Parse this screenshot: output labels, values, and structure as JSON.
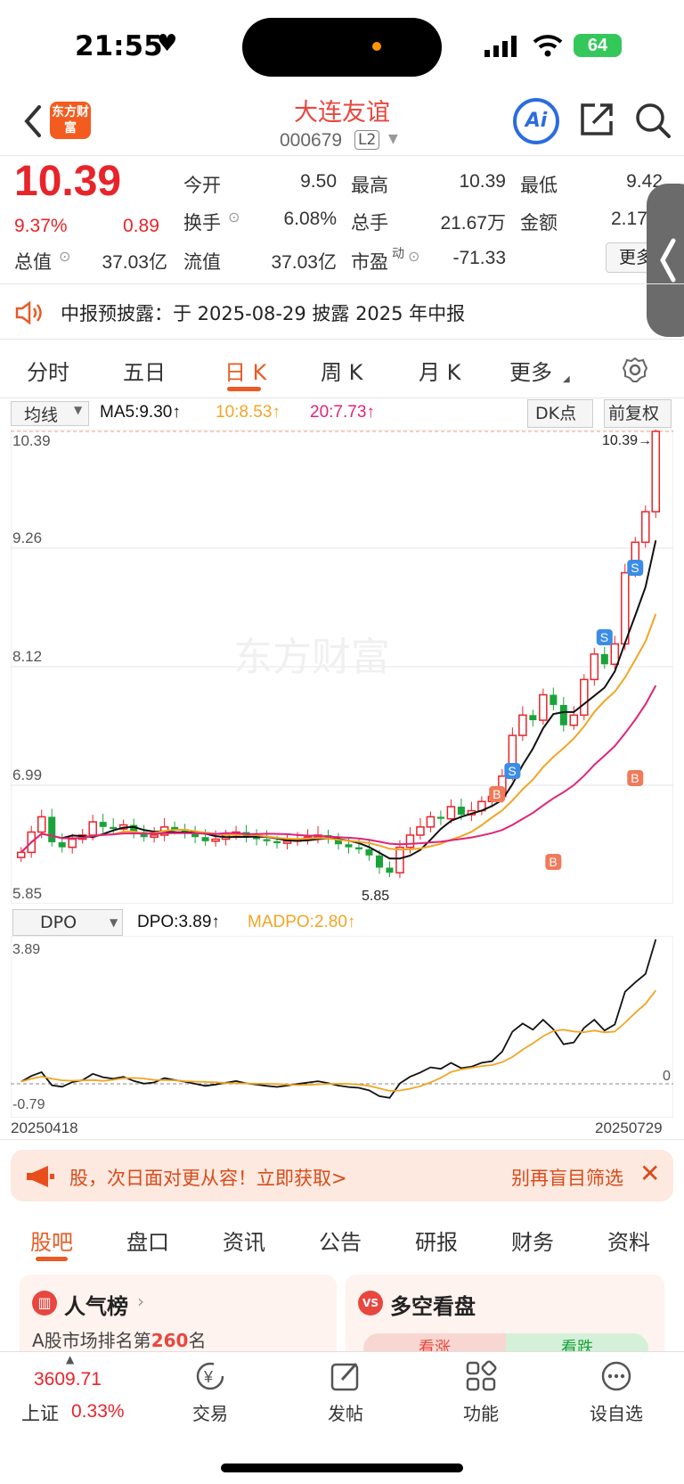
{
  "status": {
    "time": "21:55",
    "battery": "64"
  },
  "header": {
    "logo": "东方财富",
    "title": "大连友谊",
    "code": "000679",
    "level": "L2",
    "ai_label": "Ai"
  },
  "quote": {
    "price": "10.39",
    "change_pct": "9.37%",
    "change": "0.89",
    "open_label": "今开",
    "open": "9.50",
    "high_label": "最高",
    "high": "10.39",
    "low_label": "最低",
    "low": "9.42",
    "turnover_label": "换手",
    "turnover": "6.08%",
    "volume_label": "总手",
    "volume": "21.67万",
    "amount_label": "金额",
    "amount": "2.17",
    "total_mv_label": "总值",
    "total_mv": "37.03亿",
    "float_mv_label": "流值",
    "float_mv": "37.03亿",
    "pe_label": "市盈",
    "pe_sup": "动",
    "pe": "-71.33",
    "more_label": "更多"
  },
  "notice": {
    "text": "中报预披露：于 2025-08-29 披露 2025 年中报"
  },
  "chart_tabs": [
    "分时",
    "五日",
    "日 K",
    "周 K",
    "月 K",
    "更多"
  ],
  "main_chart": {
    "indicator": "均线",
    "ma5": "MA5:9.30↑",
    "ma10": "10:8.53↑",
    "ma20": "20:7.73↑",
    "dk_label": "DK点",
    "adjust_label": "前复权",
    "y_ticks": [
      "10.39",
      "9.26",
      "8.12",
      "6.99",
      "5.85"
    ],
    "max_label": "10.39→",
    "min_label": "5.85",
    "watermark": "东方财富",
    "colors": {
      "up": "#e8242a",
      "down": "#1aa33b",
      "ma5": "#111111",
      "ma10": "#f2a524",
      "ma20": "#e0237a"
    }
  },
  "sub_chart": {
    "indicator": "DPO",
    "dpo": "DPO:3.89↑",
    "madpo": "MADPO:2.80↑",
    "y_top": "3.89",
    "y_zero": "0",
    "y_bottom": "-0.79",
    "date_start": "20250418",
    "date_end": "20250729"
  },
  "chart_data": {
    "type": "candlestick",
    "ylim": [
      5.85,
      10.39
    ],
    "x_range": [
      "20250418",
      "20250729"
    ],
    "series": [
      {
        "name": "MA5",
        "value": 9.3
      },
      {
        "name": "MA10",
        "value": 8.53
      },
      {
        "name": "MA20",
        "value": 7.73
      }
    ],
    "high": 10.39,
    "low": 5.85,
    "dpo": {
      "DPO": 3.89,
      "MADPO": 2.8,
      "ylim": [
        -0.79,
        3.89
      ]
    }
  },
  "banner": {
    "text": "股，次日面对更从容！立即获取>",
    "right": "别再盲目筛选"
  },
  "bottom_tabs": [
    "股吧",
    "盘口",
    "资讯",
    "公告",
    "研报",
    "财务",
    "资料"
  ],
  "cards": {
    "popularity_title": "人气榜",
    "popularity_text_prefix": "A股市场排名第",
    "popularity_rank": "260",
    "popularity_text_suffix": "名",
    "bullbear_title": "多空看盘",
    "bull": "看涨",
    "bear": "看跌"
  },
  "nav": {
    "index_value": "3609.71",
    "index_name": "上证",
    "index_change": "0.33%",
    "items": [
      "交易",
      "发帖",
      "功能",
      "设自选"
    ]
  }
}
